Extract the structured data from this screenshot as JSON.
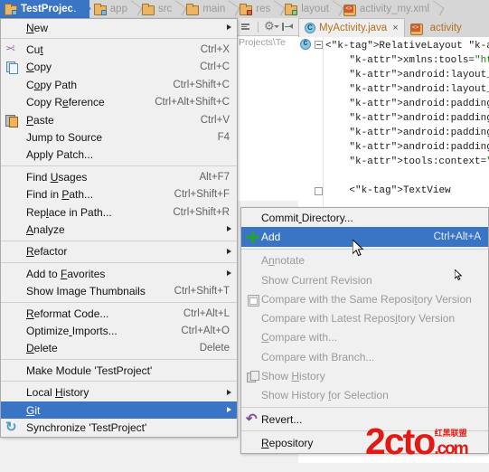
{
  "breadcrumb": {
    "name": "project-breadcrumb",
    "items": [
      {
        "label": "TestProject",
        "icon": "folder-module-icon",
        "active": true
      },
      {
        "label": "app",
        "icon": "folder-module-icon",
        "active": false
      },
      {
        "label": "src",
        "icon": "folder-icon",
        "active": false
      },
      {
        "label": "main",
        "icon": "folder-icon",
        "active": false
      },
      {
        "label": "res",
        "icon": "folder-res-icon",
        "active": false
      },
      {
        "label": "layout",
        "icon": "folder-layout-icon",
        "active": false
      },
      {
        "label": "activity_my.xml",
        "icon": "xml-file-icon",
        "active": false
      }
    ]
  },
  "project_panel": {
    "path_text": "Projects\\Te",
    "toolbar": {
      "collapse_all_label": "Collapse All",
      "settings_label": "Settings",
      "hide_label": "Hide"
    }
  },
  "editor": {
    "tabs": [
      {
        "label": "MyActivity.java",
        "icon": "java-class-icon",
        "selected": true,
        "closable": true
      },
      {
        "label": "activity",
        "icon": "xml-file-icon",
        "selected": false,
        "closable": false
      }
    ],
    "code_lines": [
      "<RelativeLayout xmlns:an",
      "    xmlns:tools=\"http://",
      "    android:layout_width",
      "    android:layout_heigh",
      "    android:paddingLeft=",
      "    android:paddingRight",
      "    android:paddingTop=\"",
      "    android:paddingBotto",
      "    tools:context=\".MyAc",
      "",
      "    <TextView"
    ]
  },
  "context_menu": {
    "name": "project-context-menu",
    "items": [
      {
        "label": "New",
        "accel": "",
        "icon": "",
        "arrow": true,
        "mnemonic": 0,
        "sep_after": true
      },
      {
        "label": "Cut",
        "accel": "Ctrl+X",
        "icon": "cut-icon",
        "arrow": false,
        "mnemonic": 2
      },
      {
        "label": "Copy",
        "accel": "Ctrl+C",
        "icon": "copy-icon",
        "arrow": false,
        "mnemonic": 0
      },
      {
        "label": "Copy Path",
        "accel": "Ctrl+Shift+C",
        "icon": "",
        "arrow": false,
        "mnemonic": 1
      },
      {
        "label": "Copy Reference",
        "accel": "Ctrl+Alt+Shift+C",
        "icon": "",
        "arrow": false,
        "mnemonic": 6
      },
      {
        "label": "Paste",
        "accel": "Ctrl+V",
        "icon": "paste-icon",
        "arrow": false,
        "mnemonic": 0
      },
      {
        "label": "Jump to Source",
        "accel": "F4",
        "icon": "",
        "arrow": false,
        "mnemonic": -1
      },
      {
        "label": "Apply Patch...",
        "accel": "",
        "icon": "",
        "arrow": false,
        "mnemonic": -1,
        "sep_after": true
      },
      {
        "label": "Find Usages",
        "accel": "Alt+F7",
        "icon": "",
        "arrow": false,
        "mnemonic": 5
      },
      {
        "label": "Find in Path...",
        "accel": "Ctrl+Shift+F",
        "icon": "",
        "arrow": false,
        "mnemonic": 8
      },
      {
        "label": "Replace in Path...",
        "accel": "Ctrl+Shift+R",
        "icon": "",
        "arrow": false,
        "mnemonic": 3
      },
      {
        "label": "Analyze",
        "accel": "",
        "icon": "",
        "arrow": true,
        "mnemonic": 0,
        "sep_after": true
      },
      {
        "label": "Refactor",
        "accel": "",
        "icon": "",
        "arrow": true,
        "mnemonic": 0,
        "sep_after": true
      },
      {
        "label": "Add to Favorites",
        "accel": "",
        "icon": "",
        "arrow": true,
        "mnemonic": 7
      },
      {
        "label": "Show Image Thumbnails",
        "accel": "Ctrl+Shift+T",
        "icon": "",
        "arrow": false,
        "mnemonic": -1,
        "sep_after": true
      },
      {
        "label": "Reformat Code...",
        "accel": "Ctrl+Alt+L",
        "icon": "",
        "arrow": false,
        "mnemonic": 0
      },
      {
        "label": "Optimize Imports...",
        "accel": "Ctrl+Alt+O",
        "icon": "",
        "arrow": false,
        "mnemonic": 8
      },
      {
        "label": "Delete",
        "accel": "Delete",
        "icon": "",
        "arrow": false,
        "mnemonic": 0,
        "sep_after": true
      },
      {
        "label": "Make Module 'TestProject'",
        "accel": "",
        "icon": "",
        "arrow": false,
        "mnemonic": -1,
        "sep_after": true
      },
      {
        "label": "Local History",
        "accel": "",
        "icon": "",
        "arrow": true,
        "mnemonic": 6
      },
      {
        "label": "Git",
        "accel": "",
        "icon": "",
        "arrow": true,
        "mnemonic": 0,
        "selected": true
      },
      {
        "label": "Synchronize 'TestProject'",
        "accel": "",
        "icon": "sync-icon",
        "arrow": false,
        "mnemonic": -1
      }
    ]
  },
  "git_submenu": {
    "name": "git-submenu",
    "items": [
      {
        "label": "Commit Directory...",
        "accel": "",
        "icon": "",
        "disabled": false,
        "selected": false,
        "mnemonic": 6
      },
      {
        "label": "Add",
        "accel": "Ctrl+Alt+A",
        "icon": "add-plus-icon",
        "disabled": false,
        "selected": true,
        "mnemonic": -1,
        "sep_after": true
      },
      {
        "label": "Annotate",
        "accel": "",
        "icon": "",
        "disabled": true,
        "selected": false,
        "mnemonic": 1
      },
      {
        "label": "Show Current Revision",
        "accel": "",
        "icon": "",
        "disabled": true,
        "selected": false,
        "mnemonic": -1
      },
      {
        "label": "Compare with the Same Repository Version",
        "accel": "",
        "icon": "compare-icon",
        "disabled": true,
        "selected": false,
        "mnemonic": 28
      },
      {
        "label": "Compare with Latest Repository Version",
        "accel": "",
        "icon": "",
        "disabled": true,
        "selected": false,
        "mnemonic": 25
      },
      {
        "label": "Compare with...",
        "accel": "",
        "icon": "",
        "disabled": true,
        "selected": false,
        "mnemonic": 0
      },
      {
        "label": "Compare with Branch...",
        "accel": "",
        "icon": "",
        "disabled": true,
        "selected": false,
        "mnemonic": -1
      },
      {
        "label": "Show History",
        "accel": "",
        "icon": "history-icon",
        "disabled": true,
        "selected": false,
        "mnemonic": 5
      },
      {
        "label": "Show History for Selection",
        "accel": "",
        "icon": "",
        "disabled": true,
        "selected": false,
        "mnemonic": 13,
        "sep_after": true
      },
      {
        "label": "Revert...",
        "accel": "",
        "icon": "revert-icon",
        "disabled": false,
        "selected": false,
        "mnemonic": -1,
        "sep_after": true
      },
      {
        "label": "Repository",
        "accel": "",
        "icon": "",
        "disabled": false,
        "selected": false,
        "mnemonic": 0
      }
    ]
  },
  "watermark": {
    "text": "2cto",
    "suffix": ".com",
    "cn_text": "红黑联盟"
  },
  "colors": {
    "accent_blue": "#3a74c4",
    "menu_bg": "#f0f0f0",
    "breadcrumb_bg": "#d6d6d6",
    "disabled_text": "#9a9a9a",
    "accel_text": "#616161",
    "watermark_red": "#e01a14",
    "add_green": "#27a327"
  }
}
